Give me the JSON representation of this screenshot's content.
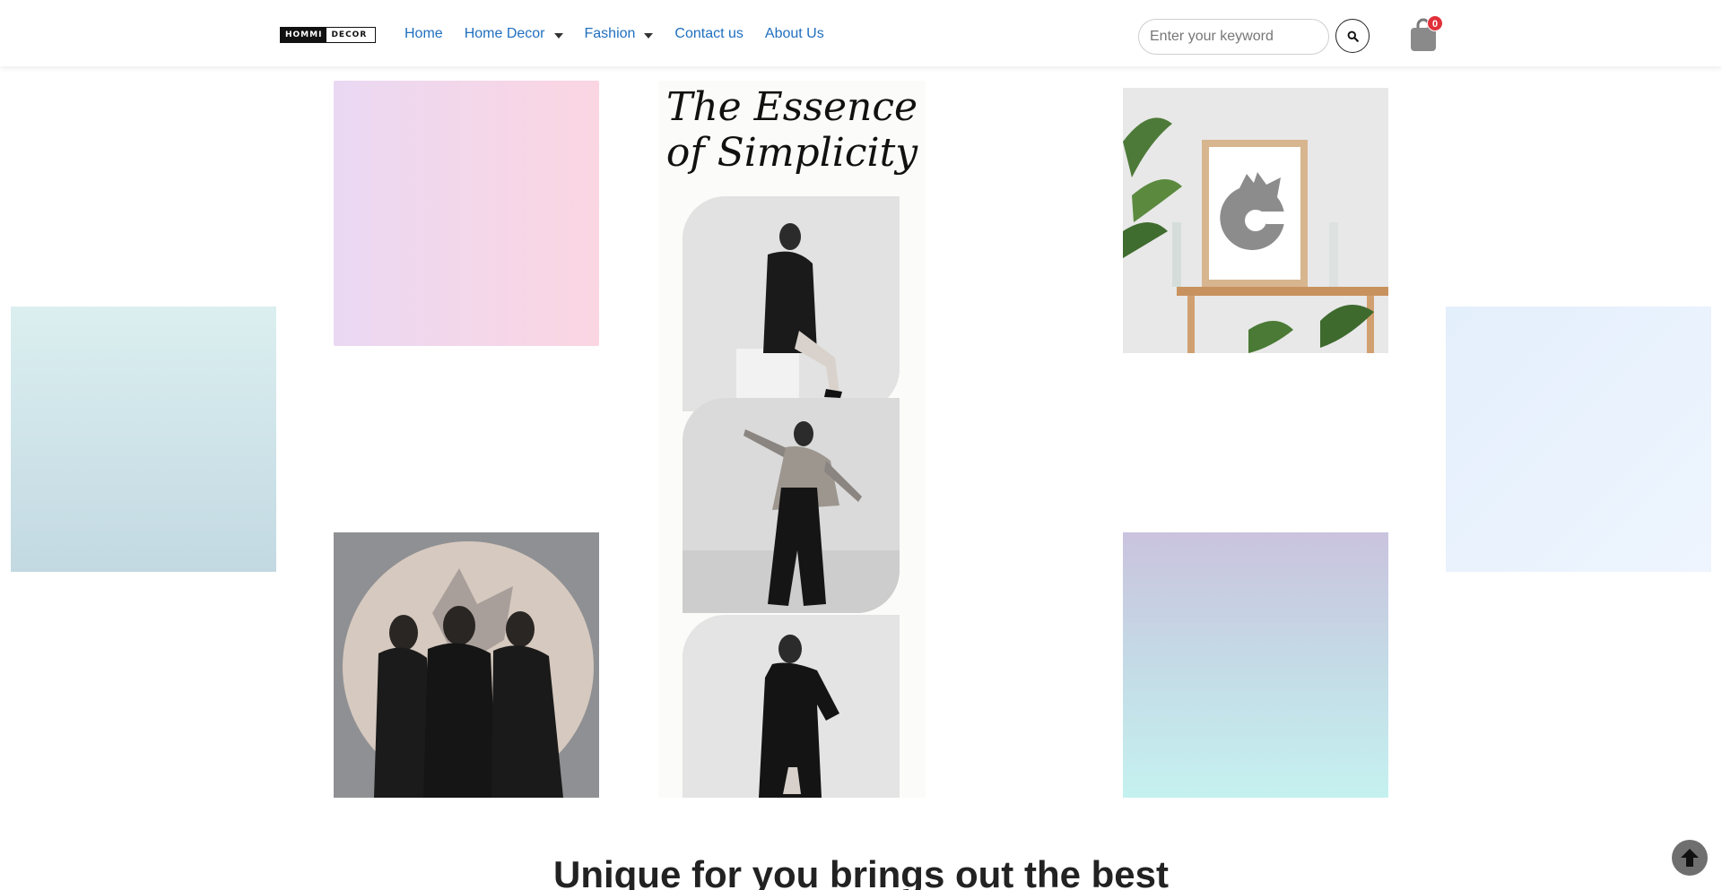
{
  "header": {
    "logo": {
      "part1": "HOMMI",
      "part2": "DECOR"
    },
    "nav": [
      {
        "label": "Home",
        "has_dropdown": false
      },
      {
        "label": "Home Decor",
        "has_dropdown": true
      },
      {
        "label": "Fashion",
        "has_dropdown": true
      },
      {
        "label": "Contact us",
        "has_dropdown": false
      },
      {
        "label": "About Us",
        "has_dropdown": false
      }
    ],
    "search": {
      "placeholder": "Enter your keyword",
      "value": ""
    },
    "search_icon": "search-icon",
    "cart": {
      "icon": "shopping-bag-icon",
      "count": "0"
    },
    "colors": {
      "nav_link": "#1f6fbf",
      "badge": "#e0303a"
    }
  },
  "gallery": {
    "poster": {
      "title_line1": "The Essence",
      "title_line2": "of Simplicity"
    },
    "room_icon": "wolf-logo-icon"
  },
  "section": {
    "heading": "Unique for you brings out the best"
  },
  "back_to_top_icon": "arrow-up-icon"
}
